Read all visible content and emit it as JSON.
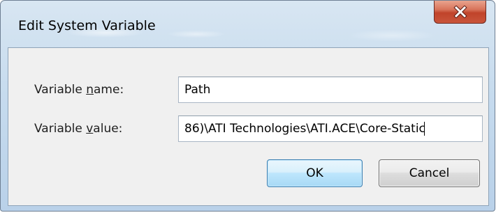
{
  "dialog": {
    "title": "Edit System Variable",
    "close_icon": "close-x-icon"
  },
  "form": {
    "name_label_pre": "Variable ",
    "name_label_key": "n",
    "name_label_post": "ame:",
    "name_value": "Path",
    "value_label_pre": "Variable ",
    "value_label_key": "v",
    "value_label_post": "alue:",
    "value_value": "86)\\ATI Technologies\\ATI.ACE\\Core-Static"
  },
  "buttons": {
    "ok_label": "OK",
    "cancel_label": "Cancel"
  }
}
